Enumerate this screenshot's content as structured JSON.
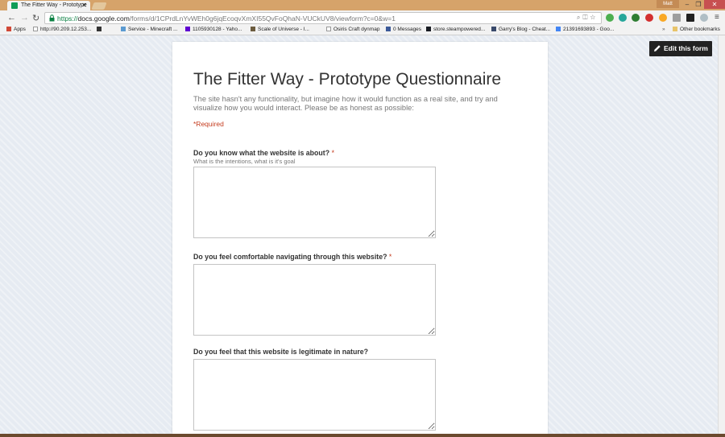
{
  "browser": {
    "tab_title": "The Fitter Way - Prototype",
    "user_name": "Matt",
    "url_scheme": "https://",
    "url_host": "docs.google.com",
    "url_path": "/forms/d/1CPrdLnYvWEh0g6jqEcoqvXmXI55QvFoQhaN-VUCkUV8/viewform?c=0&w=1",
    "bookmarks": [
      "Apps",
      "http://90.209.12.253...",
      "Service - Minecraft ...",
      "1105930128 - Yaho...",
      "Scale of Universe - I...",
      "Osiris Craft dynmap",
      "0 Messages",
      "store.steampowered...",
      "Garry's Blog - Cheat...",
      "21391693893 - Goo...",
      "Other bookmarks"
    ]
  },
  "page": {
    "edit_label": "Edit this form"
  },
  "form": {
    "title": "The Fitter Way - Prototype Questionnaire",
    "description": "The site hasn't any functionality, but imagine how it would function as a real site, and try and visualize how you would interact. Please be as honest as possible:",
    "required_note": "*Required",
    "questions": [
      {
        "title": "Do you know what the website is about?",
        "required_mark": "*",
        "help": "What is the intentions, what is it's goal",
        "answer": ""
      },
      {
        "title": "Do you feel comfortable navigating through this website?",
        "required_mark": "*",
        "help": "",
        "answer": ""
      },
      {
        "title": "Do you feel that this website is legitimate in nature?",
        "required_mark": "",
        "help": "",
        "answer": ""
      }
    ]
  }
}
